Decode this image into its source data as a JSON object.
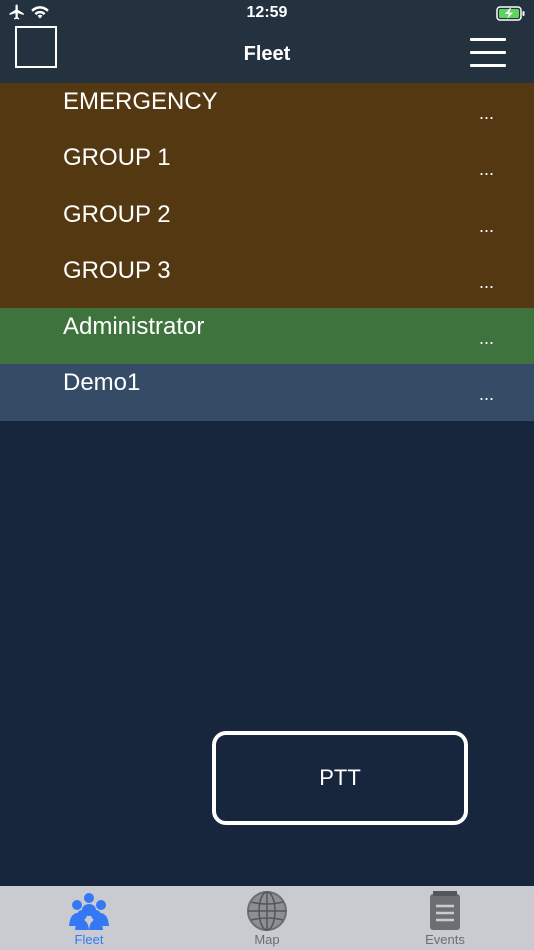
{
  "status_bar": {
    "time": "12:59"
  },
  "nav": {
    "title": "Fleet"
  },
  "list": {
    "rows": [
      {
        "label": "EMERGENCY",
        "more": "...",
        "color": "#533811"
      },
      {
        "label": "GROUP 1",
        "more": "...",
        "color": "#533811"
      },
      {
        "label": "GROUP 2",
        "more": "...",
        "color": "#533811"
      },
      {
        "label": "GROUP 3",
        "more": "...",
        "color": "#533811"
      },
      {
        "label": "Administrator",
        "more": "...",
        "color": "#3e733e"
      },
      {
        "label": "Demo1",
        "more": "...",
        "color": "#344c66"
      }
    ]
  },
  "ptt": {
    "label": "PTT"
  },
  "tabs": [
    {
      "label": "Fleet",
      "icon": "people-icon",
      "active": true
    },
    {
      "label": "Map",
      "icon": "globe-icon",
      "active": false
    },
    {
      "label": "Events",
      "icon": "notepad-icon",
      "active": false
    }
  ],
  "colors": {
    "accent": "#3478f6",
    "background": "#17263d",
    "navbar": "#24313f"
  }
}
